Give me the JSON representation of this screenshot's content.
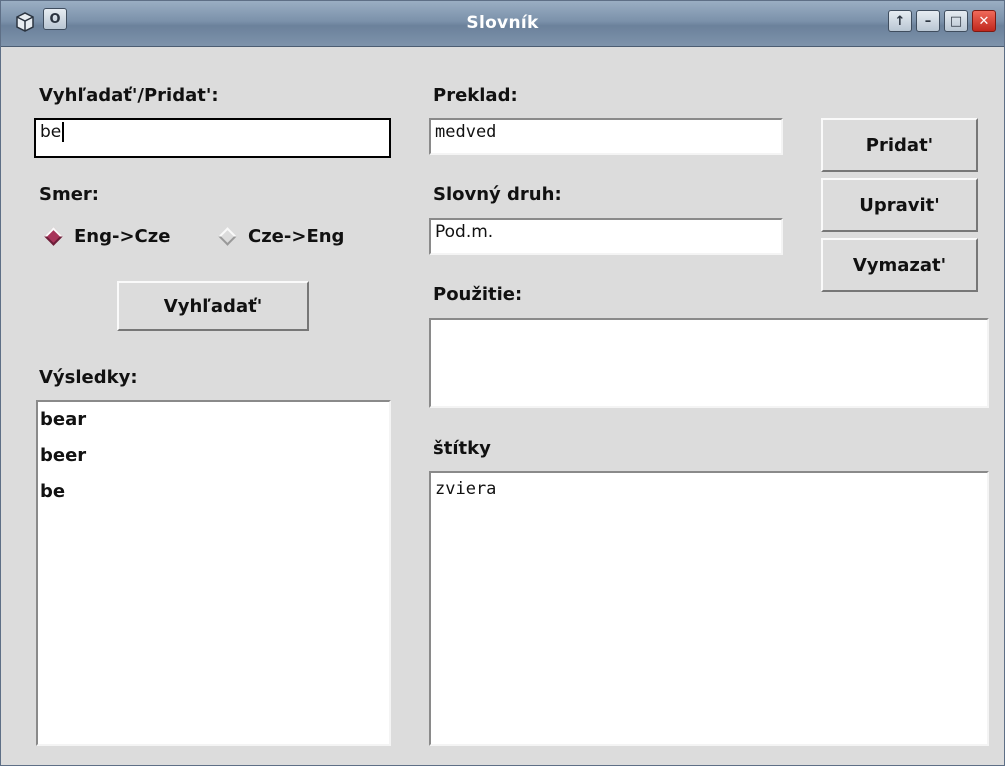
{
  "window": {
    "title": "Slovník",
    "controls": {
      "menu_glyph": "O",
      "shade_glyph": "↑",
      "minimize_glyph": "–",
      "maximize_glyph": "□",
      "close_glyph": "✕"
    }
  },
  "search": {
    "label": "Vyhľadať'/Pridat':",
    "value": "be"
  },
  "direction": {
    "label": "Smer:",
    "options": [
      {
        "label": "Eng->Cze",
        "selected": true
      },
      {
        "label": "Cze->Eng",
        "selected": false
      }
    ]
  },
  "search_button": "Vyhľadať'",
  "results": {
    "label": "Výsledky:",
    "items": [
      "bear",
      "beer",
      "be"
    ]
  },
  "translation": {
    "label": "Preklad:",
    "value": "medved"
  },
  "word_class": {
    "label": "Slovný druh:",
    "value": "Pod.m."
  },
  "usage": {
    "label": "Použitie:",
    "value": ""
  },
  "tags": {
    "label": "štítky",
    "value": "zviera"
  },
  "actions": {
    "add": "Pridat'",
    "edit": "Upravit'",
    "delete": "Vymazat'"
  },
  "colors": {
    "title_bar": "#7b91aa",
    "radio_selected": "#a8345a",
    "window_bg": "#dcdcdc",
    "close_button": "#c0271d"
  }
}
